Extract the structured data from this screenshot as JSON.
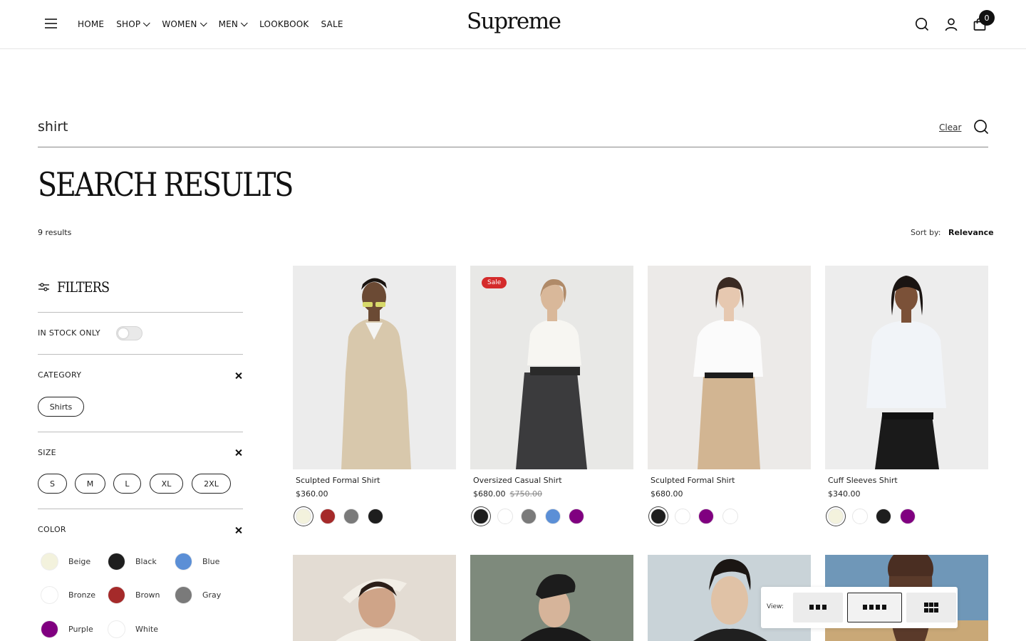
{
  "header": {
    "logo": "Supreme",
    "nav": [
      {
        "label": "HOME",
        "has_dropdown": false
      },
      {
        "label": "SHOP",
        "has_dropdown": true
      },
      {
        "label": "WOMEN",
        "has_dropdown": true
      },
      {
        "label": "MEN",
        "has_dropdown": true
      },
      {
        "label": "LOOKBOOK",
        "has_dropdown": false
      },
      {
        "label": "SALE",
        "has_dropdown": false
      }
    ],
    "cart_count": "0",
    "icons": [
      "menu-icon",
      "search-icon",
      "account-icon",
      "cart-icon"
    ]
  },
  "search": {
    "query": "shirt",
    "clear_label": "Clear"
  },
  "page": {
    "title": "SEARCH RESULTS",
    "results_count": "9 results",
    "sort_label": "Sort by:",
    "sort_value": "Relevance"
  },
  "filters": {
    "title": "FILTERS",
    "in_stock_label": "IN STOCK ONLY",
    "in_stock_on": false,
    "category": {
      "label": "CATEGORY",
      "options": [
        "Shirts"
      ]
    },
    "size": {
      "label": "SIZE",
      "options": [
        "S",
        "M",
        "L",
        "XL",
        "2XL"
      ]
    },
    "color": {
      "label": "COLOR",
      "options": [
        {
          "name": "Beige",
          "hex": "#f3f2dd"
        },
        {
          "name": "Black",
          "hex": "#1e1e1e"
        },
        {
          "name": "Blue",
          "hex": "#5b8fd6"
        },
        {
          "name": "Bronze",
          "hex": "#ffffff"
        },
        {
          "name": "Brown",
          "hex": "#a52a2a"
        },
        {
          "name": "Gray",
          "hex": "#7a7a7a"
        },
        {
          "name": "Purple",
          "hex": "#800080"
        },
        {
          "name": "White",
          "hex": "#ffffff"
        }
      ]
    }
  },
  "products": [
    {
      "name": "Sculpted Formal Shirt",
      "price": "$360.00",
      "old_price": "",
      "sale": false,
      "swatches": [
        "#f3f2dd",
        "#a52a2a",
        "#7a7a7a",
        "#1e1e1e"
      ],
      "selected": 0
    },
    {
      "name": "Oversized Casual Shirt",
      "price": "$680.00",
      "old_price": "$750.00",
      "sale": true,
      "sale_label": "Sale",
      "swatches": [
        "#1e1e1e",
        "#ffffff",
        "#7a7a7a",
        "#5b8fd6",
        "#800080"
      ],
      "selected": 0
    },
    {
      "name": "Sculpted Formal Shirt",
      "price": "$680.00",
      "old_price": "",
      "sale": false,
      "swatches": [
        "#1e1e1e",
        "#ffffff",
        "#800080",
        "#ffffff"
      ],
      "selected": 0
    },
    {
      "name": "Cuff Sleeves Shirt",
      "price": "$340.00",
      "old_price": "",
      "sale": false,
      "swatches": [
        "#f3f2dd",
        "#ffffff",
        "#1e1e1e",
        "#800080"
      ],
      "selected": 0
    }
  ],
  "view_switch": {
    "label": "View:",
    "options": [
      "3 columns",
      "4 columns",
      "grid"
    ],
    "active": 1
  }
}
